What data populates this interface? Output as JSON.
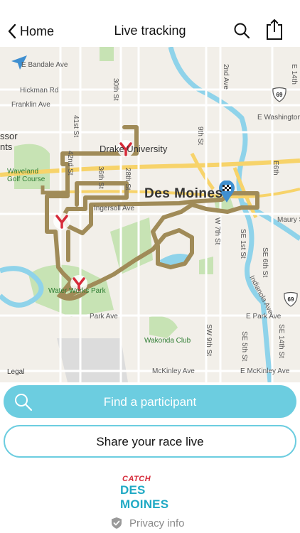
{
  "nav": {
    "back_label": "Home",
    "title": "Live tracking"
  },
  "map": {
    "city_label": "Des Moines",
    "streets": {
      "ebandale": "E Bandale Ave",
      "hickman": "Hickman Rd",
      "franklin": "Franklin Ave",
      "ingersoll": "Ingersoll Ave",
      "park": "Park Ave",
      "e_park": "E Park Ave",
      "mckinley": "McKinley Ave",
      "e_mckinley": "E McKinley Ave",
      "maury": "Maury S",
      "e_washington": "E Washington",
      "st_30th": "30th St",
      "st_41st": "41st St",
      "st_42nd": "42nd St",
      "st_36th": "36th St",
      "st_28th": "28th St",
      "st_9th": "9th St",
      "st_2nd": "2nd Ave",
      "st_e6th": "E6th",
      "st_w7th": "W 7th St",
      "st_se1st": "SE 1st St",
      "st_se6th": "SE 6th St",
      "st_sw9th": "SW 9th St",
      "st_se14": "SE 14th St",
      "st_se5": "SE 5th St",
      "indianola": "Indianola Ave",
      "st_e14": "E 14th"
    },
    "places": {
      "drake": "Drake University",
      "waveland": "Waveland Golf Course",
      "waterworks": "Water Works Park",
      "wakonda": "Wakonda Club",
      "sor": "ssor",
      "nts": "nts"
    },
    "shields": [
      "69",
      "69"
    ],
    "legal": "Legal",
    "route_color": "#a08b58",
    "marker_color": "#d62b3a",
    "finish_color": "#3f8fd0"
  },
  "actions": {
    "find_label": "Find a participant",
    "share_label": "Share your race live"
  },
  "logo": {
    "line1": "CATCH",
    "line2": "DES MOINES"
  },
  "privacy_label": "Privacy info"
}
